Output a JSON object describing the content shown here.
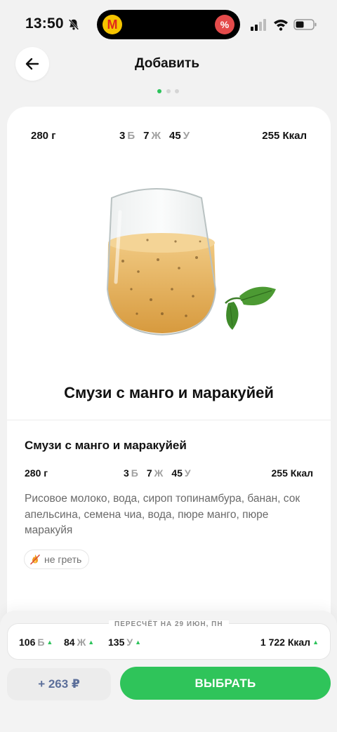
{
  "status_bar": {
    "time": "13:50",
    "island_app_letter": "М",
    "island_badge": "%"
  },
  "header": {
    "title": "Добавить"
  },
  "product": {
    "weight": "280 г",
    "protein": "3",
    "protein_letter": "Б",
    "fat": "7",
    "fat_letter": "Ж",
    "carbs": "45",
    "carbs_letter": "У",
    "kcal": "255 Ккал",
    "name": "Смузи с манго и маракуйей",
    "ingredients": "Рисовое молоко, вода, сироп топинамбура,  банан, сок апельсина, семена чиа, вода, пюре манго, пюре маракуйя",
    "tag": "не греть"
  },
  "recalc": {
    "label": "ПЕРЕСЧЁТ НА 29 ИЮН, ПН",
    "protein": "106",
    "protein_letter": "Б",
    "fat": "84",
    "fat_letter": "Ж",
    "carbs": "135",
    "carbs_letter": "У",
    "kcal": "1 722 Ккал"
  },
  "actions": {
    "price": "+ 263 ₽",
    "select_label": "ВЫБРАТЬ"
  },
  "colors": {
    "accent": "#2fc45a",
    "price_text": "#5c6f9a",
    "background": "#f2f2f2"
  },
  "icons": [
    "bell-slash-icon",
    "signal-icon",
    "wifi-icon",
    "battery-icon",
    "arrow-left-icon",
    "no-heat-icon",
    "arrow-up-icon"
  ]
}
